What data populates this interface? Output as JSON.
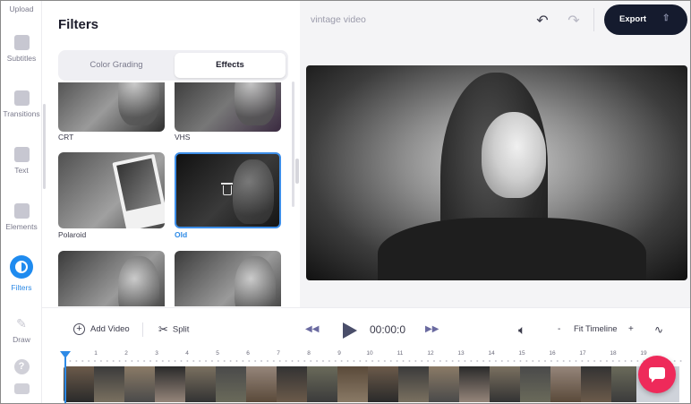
{
  "rail": {
    "items": [
      {
        "label": "Upload",
        "icon": "upload-icon"
      },
      {
        "label": "Subtitles",
        "icon": "subtitles-icon"
      },
      {
        "label": "Transitions",
        "icon": "transitions-icon"
      },
      {
        "label": "Text",
        "icon": "text-icon"
      },
      {
        "label": "Elements",
        "icon": "elements-icon"
      },
      {
        "label": "Filters",
        "icon": "filters-icon",
        "active": true
      },
      {
        "label": "Draw",
        "icon": "draw-icon"
      }
    ],
    "extra_icons": [
      "help-icon",
      "keyboard-icon"
    ]
  },
  "panel": {
    "title": "Filters",
    "tabs": [
      {
        "label": "Color Grading",
        "active": false
      },
      {
        "label": "Effects",
        "active": true
      }
    ],
    "filters": [
      {
        "label": "CRT"
      },
      {
        "label": "VHS"
      },
      {
        "label": "Polaroid"
      },
      {
        "label": "Old",
        "selected": true
      },
      {
        "label": ""
      },
      {
        "label": ""
      }
    ]
  },
  "header": {
    "project_name": "vintage video",
    "undo_icon": "undo-icon",
    "redo_icon": "redo-icon",
    "export_label": "Export",
    "export_icon": "upload-icon"
  },
  "toolbar": {
    "add_video_label": "Add Video",
    "split_label": "Split",
    "timecode": "00:00:0",
    "zoom_minus": "-",
    "fit_label": "Fit Timeline",
    "zoom_plus": "+"
  },
  "timeline": {
    "ticks": [
      "1",
      "2",
      "3",
      "4",
      "5",
      "6",
      "7",
      "8",
      "9",
      "10",
      "11",
      "12",
      "13",
      "14",
      "15",
      "16",
      "17",
      "18",
      "19"
    ]
  },
  "colors": {
    "accent": "#2d8ae6",
    "export_bg": "#151b2e",
    "chat": "#ee2a5a"
  }
}
